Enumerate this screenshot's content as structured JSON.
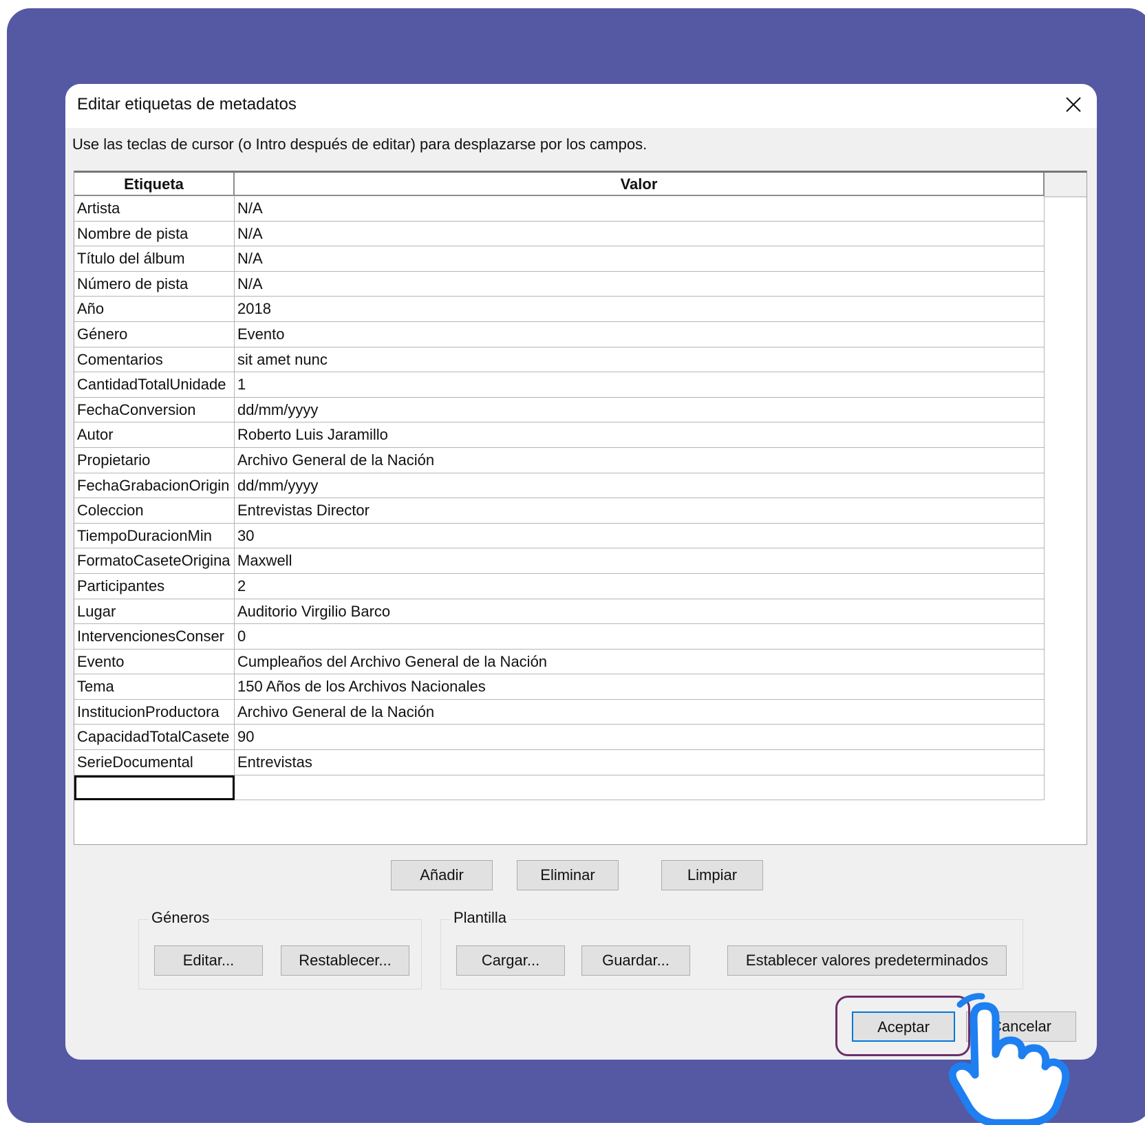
{
  "dialog": {
    "title": "Editar etiquetas de metadatos",
    "instruction": "Use las teclas de cursor (o Intro después de editar) para desplazarse por los campos."
  },
  "table": {
    "headers": {
      "tag": "Etiqueta",
      "value": "Valor"
    },
    "rows": [
      {
        "tag": "Artista",
        "value": "N/A"
      },
      {
        "tag": "Nombre de pista",
        "value": "N/A"
      },
      {
        "tag": "Título del álbum",
        "value": "N/A"
      },
      {
        "tag": "Número de pista",
        "value": "N/A"
      },
      {
        "tag": "Año",
        "value": "2018"
      },
      {
        "tag": "Género",
        "value": "Evento"
      },
      {
        "tag": "Comentarios",
        "value": "sit amet nunc"
      },
      {
        "tag": "CantidadTotalUnidade",
        "value": "1"
      },
      {
        "tag": "FechaConversion",
        "value": "dd/mm/yyyy"
      },
      {
        "tag": "Autor",
        "value": "Roberto Luis Jaramillo"
      },
      {
        "tag": "Propietario",
        "value": "Archivo General de la Nación"
      },
      {
        "tag": "FechaGrabacionOrigin",
        "value": "dd/mm/yyyy"
      },
      {
        "tag": "Coleccion",
        "value": "Entrevistas Director"
      },
      {
        "tag": "TiempoDuracionMin",
        "value": "30"
      },
      {
        "tag": "FormatoCaseteOrigina",
        "value": "Maxwell"
      },
      {
        "tag": "Participantes",
        "value": "2"
      },
      {
        "tag": "Lugar",
        "value": "Auditorio Virgilio Barco"
      },
      {
        "tag": "IntervencionesConser",
        "value": "0"
      },
      {
        "tag": "Evento",
        "value": "Cumpleaños del Archivo General de la Nación"
      },
      {
        "tag": "Tema",
        "value": "150 Años de los Archivos Nacionales"
      },
      {
        "tag": "InstitucionProductora",
        "value": "Archivo General de la Nación"
      },
      {
        "tag": "CapacidadTotalCasete",
        "value": "90"
      },
      {
        "tag": "SerieDocumental",
        "value": "Entrevistas"
      },
      {
        "tag": "",
        "value": ""
      }
    ]
  },
  "row_buttons": {
    "add": "Añadir",
    "delete": "Eliminar",
    "clear": "Limpiar"
  },
  "genres_group": {
    "label": "Géneros",
    "edit": "Editar...",
    "reset": "Restablecer..."
  },
  "template_group": {
    "label": "Plantilla",
    "load": "Cargar...",
    "save": "Guardar...",
    "set_defaults": "Establecer valores predeterminados"
  },
  "footer": {
    "ok": "Aceptar",
    "cancel": "Cancelar"
  },
  "colors": {
    "backdrop": "#5558a3",
    "highlight": "#6b2f6b",
    "hand": "#1e7ff0"
  }
}
